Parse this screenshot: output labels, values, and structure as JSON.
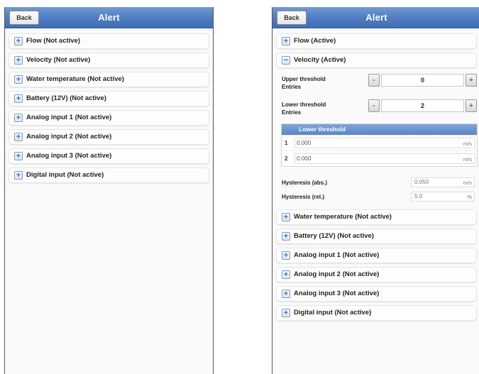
{
  "left": {
    "header": {
      "back": "Back",
      "title": "Alert"
    },
    "items": [
      "Flow (Not active)",
      "Velocity (Not active)",
      "Water temperature (Not active)",
      "Battery (12V) (Not active)",
      "Analog input 1 (Not active)",
      "Analog input 2 (Not active)",
      "Analog input 3 (Not active)",
      "Digital input (Not active)"
    ]
  },
  "right": {
    "header": {
      "back": "Back",
      "title": "Alert"
    },
    "flow": {
      "icon": "+",
      "label": "Flow (Active)"
    },
    "velocity": {
      "icon": "−",
      "label": "Velocity (Active)"
    },
    "upper": {
      "label_1": "Upper threshold",
      "label_2": "Entries",
      "minus": "-",
      "value": "0",
      "plus": "+"
    },
    "lower": {
      "label_1": "Lower threshold",
      "label_2": "Entries",
      "minus": "-",
      "value": "2",
      "plus": "+"
    },
    "lower_table": {
      "header": "Lower threshold",
      "rows": [
        {
          "index": "1",
          "value": "0.000",
          "unit": "m/s"
        },
        {
          "index": "2",
          "value": "0.000",
          "unit": "m/s"
        }
      ]
    },
    "hysteresis_abs": {
      "label": "Hysteresis (abs.)",
      "value": "0.050",
      "unit": "m/s"
    },
    "hysteresis_rel": {
      "label": "Hysteresis (rel.)",
      "value": "5.0",
      "unit": "%"
    },
    "items": [
      "Water temperature (Not active)",
      "Battery (12V) (Not active)",
      "Analog input 1 (Not active)",
      "Analog input 2 (Not active)",
      "Analog input 3 (Not active)",
      "Digital input (Not active)"
    ]
  },
  "icons": {
    "expand": "+",
    "collapse": "−"
  }
}
